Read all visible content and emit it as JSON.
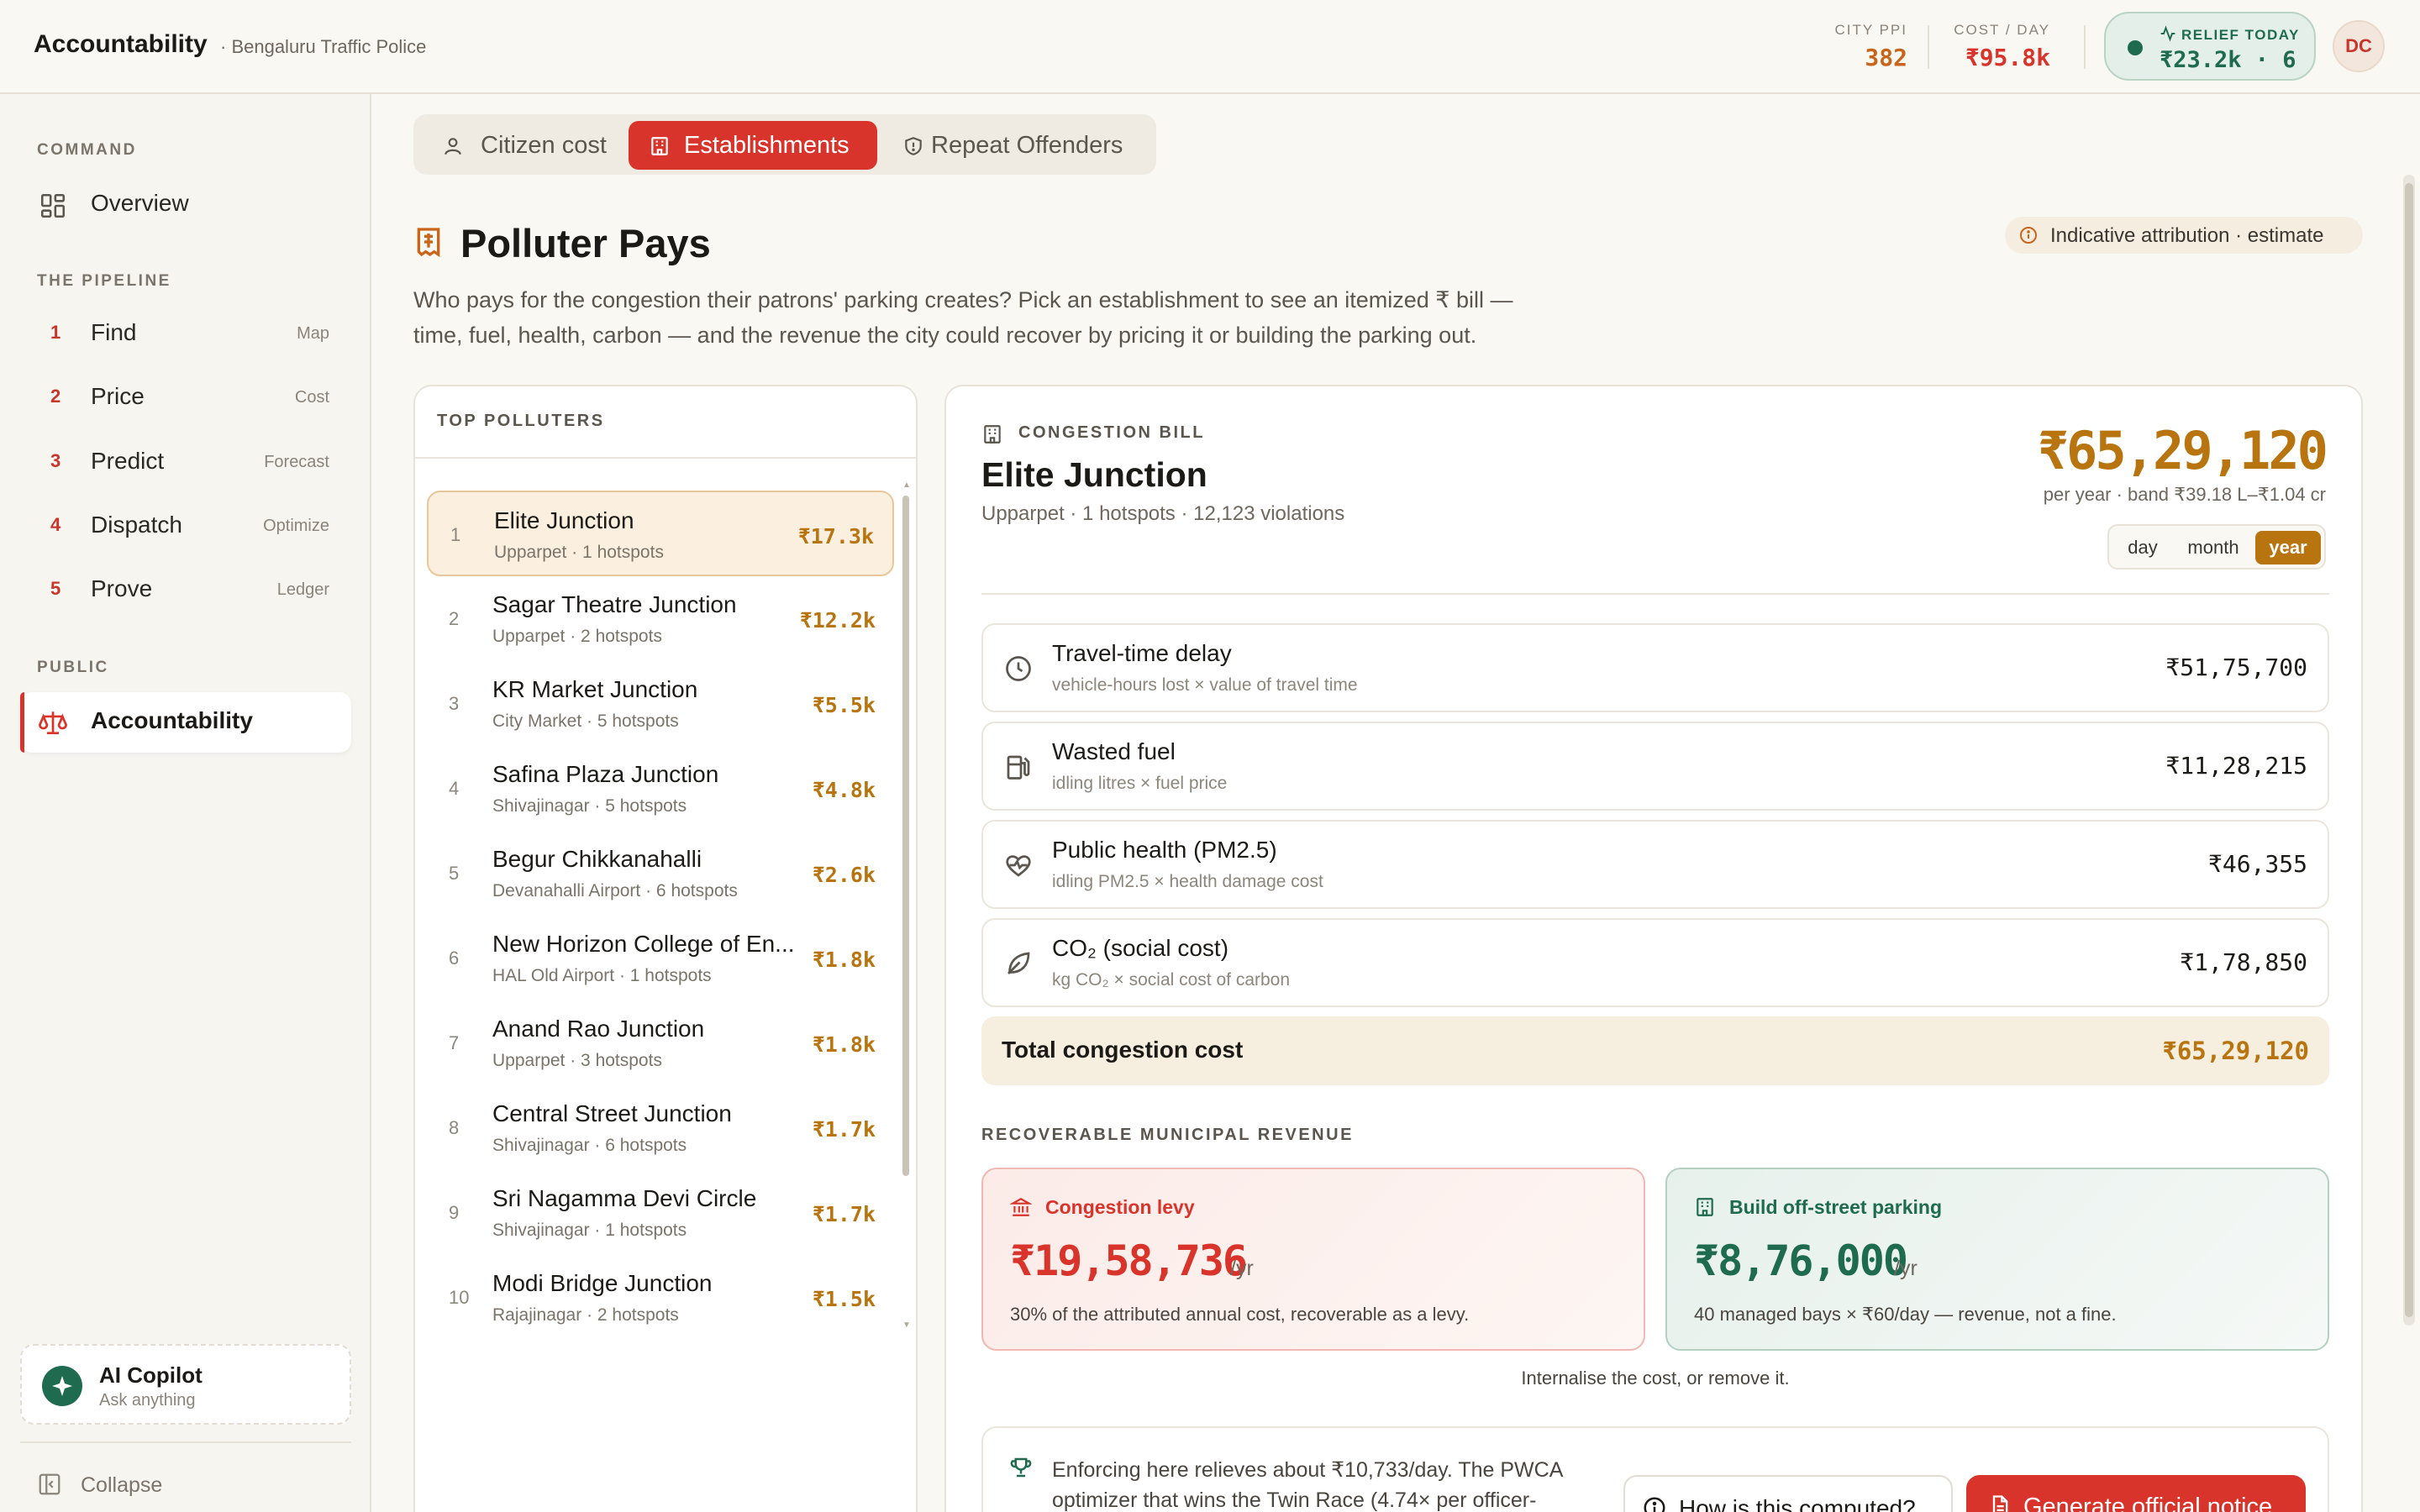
{
  "header": {
    "title": "Accountability",
    "subtitle": "· Bengaluru Traffic Police",
    "city_ppi_label": "CITY PPI",
    "city_ppi_value": "382",
    "cost_day_label": "COST / DAY",
    "cost_day_value": "₹95.8k",
    "relief_label": "RELIEF TODAY",
    "relief_value": "₹23.2k · 6",
    "avatar": "DC"
  },
  "sidebar": {
    "command_heading": "COMMAND",
    "overview_label": "Overview",
    "pipeline_heading": "THE PIPELINE",
    "pipeline": [
      {
        "num": "1",
        "label": "Find",
        "tag": "Map"
      },
      {
        "num": "2",
        "label": "Price",
        "tag": "Cost"
      },
      {
        "num": "3",
        "label": "Predict",
        "tag": "Forecast"
      },
      {
        "num": "4",
        "label": "Dispatch",
        "tag": "Optimize"
      },
      {
        "num": "5",
        "label": "Prove",
        "tag": "Ledger"
      }
    ],
    "public_heading": "PUBLIC",
    "accountability_label": "Accountability",
    "copilot_title": "AI Copilot",
    "copilot_sub": "Ask anything",
    "collapse_label": "Collapse"
  },
  "tabs": [
    {
      "label": "Citizen cost",
      "icon": "user-icon"
    },
    {
      "label": "Establishments",
      "icon": "building-icon"
    },
    {
      "label": "Repeat Offenders",
      "icon": "shield-icon"
    }
  ],
  "page": {
    "title": "Polluter Pays",
    "badge": "Indicative attribution · estimate",
    "description_line1": "Who pays for the congestion their patrons' parking creates? Pick an establishment to see an itemized ₹ bill —",
    "description_line2": "time, fuel, health, carbon — and the revenue the city could recover by pricing it or building the parking out."
  },
  "polluters": {
    "heading": "TOP POLLUTERS",
    "items": [
      {
        "rank": "1",
        "name": "Elite Junction",
        "sub": "Upparpet · 1 hotspots",
        "value": "₹17.3k"
      },
      {
        "rank": "2",
        "name": "Sagar Theatre Junction",
        "sub": "Upparpet · 2 hotspots",
        "value": "₹12.2k"
      },
      {
        "rank": "3",
        "name": "KR Market Junction",
        "sub": "City Market · 5 hotspots",
        "value": "₹5.5k"
      },
      {
        "rank": "4",
        "name": "Safina Plaza Junction",
        "sub": "Shivajinagar · 5 hotspots",
        "value": "₹4.8k"
      },
      {
        "rank": "5",
        "name": "Begur Chikkanahalli",
        "sub": "Devanahalli Airport · 6 hotspots",
        "value": "₹2.6k"
      },
      {
        "rank": "6",
        "name": "New Horizon College of En...",
        "sub": "HAL Old Airport · 1 hotspots",
        "value": "₹1.8k"
      },
      {
        "rank": "7",
        "name": "Anand Rao Junction",
        "sub": "Upparpet · 3 hotspots",
        "value": "₹1.8k"
      },
      {
        "rank": "8",
        "name": "Central Street Junction",
        "sub": "Shivajinagar · 6 hotspots",
        "value": "₹1.7k"
      },
      {
        "rank": "9",
        "name": "Sri Nagamma Devi Circle",
        "sub": "Shivajinagar · 1 hotspots",
        "value": "₹1.7k"
      },
      {
        "rank": "10",
        "name": "Modi Bridge Junction",
        "sub": "Rajajinagar · 2 hotspots",
        "value": "₹1.5k"
      }
    ]
  },
  "bill": {
    "label": "CONGESTION BILL",
    "name": "Elite Junction",
    "sub": "Upparpet · 1 hotspots · 12,123 violations",
    "amount": "₹65,29,120",
    "amount_sub": "per year · band ₹39.18 L–₹1.04 cr",
    "periods": [
      "day",
      "month",
      "year"
    ],
    "active_period": "year",
    "lines": [
      {
        "title": "Travel-time delay",
        "sub": "vehicle-hours lost × value of travel time",
        "value": "₹51,75,700",
        "icon": "clock-icon"
      },
      {
        "title": "Wasted fuel",
        "sub": "idling litres × fuel price",
        "value": "₹11,28,215",
        "icon": "fuel-icon"
      },
      {
        "title": "Public health (PM2.5)",
        "sub": "idling PM2.5 × health damage cost",
        "value": "₹46,355",
        "icon": "heart-pulse-icon"
      },
      {
        "title": "CO₂ (social cost)",
        "sub": "kg CO₂ × social cost of carbon",
        "value": "₹1,78,850",
        "icon": "leaf-icon"
      }
    ],
    "total_label": "Total congestion cost",
    "total_value": "₹65,29,120"
  },
  "revenue": {
    "heading": "RECOVERABLE MUNICIPAL REVENUE",
    "levy_title": "Congestion levy",
    "levy_value": "₹19,58,736",
    "levy_unit": "/yr",
    "levy_note": "30% of the attributed annual cost, recoverable as a levy.",
    "parking_title": "Build off-street parking",
    "parking_value": "₹8,76,000",
    "parking_unit": "/yr",
    "parking_note": "40 managed bays × ₹60/day — revenue, not a fine.",
    "tagline": "Internalise the cost, or remove it."
  },
  "footer": {
    "text_line1": "Enforcing here relieves about ₹10,733/day. The PWCA",
    "text_line2": "optimizer that wins the Twin Race (4.74× per officer-",
    "how_label": "How is this computed?",
    "notice_label": "Generate official notice"
  },
  "colors": {
    "accent_red": "#d9342b",
    "amber": "#b8740e",
    "green": "#1f6b4f"
  }
}
